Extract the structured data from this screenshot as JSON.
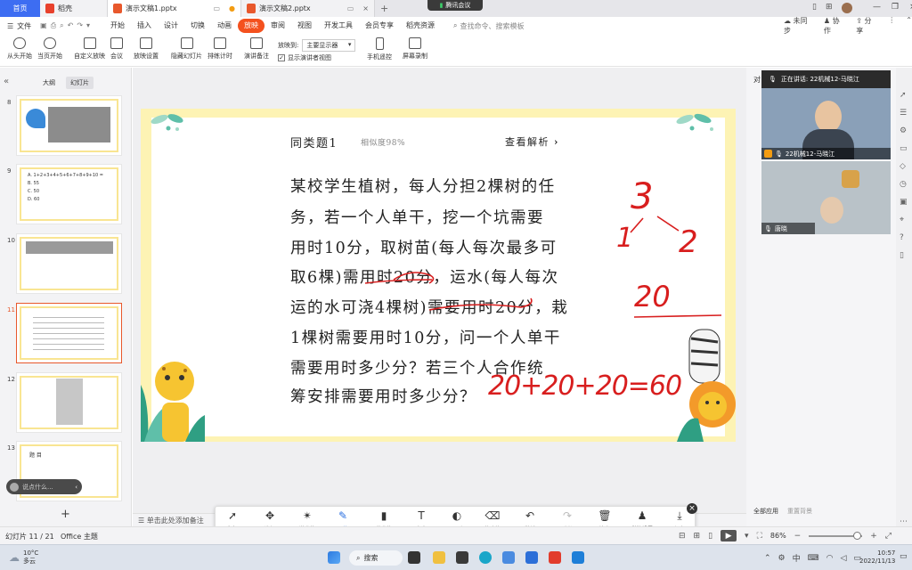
{
  "tabs": {
    "home": "首页",
    "daoke": "稻壳",
    "doc1": "演示文稿1.pptx",
    "doc2": "演示文稿2.pptx",
    "meeting": "腾讯会议"
  },
  "window": {
    "sync": "未同步",
    "collab": "协作",
    "share": "分享"
  },
  "menu": {
    "file": "文件",
    "items": [
      "开始",
      "插入",
      "设计",
      "切换",
      "动画",
      "放映",
      "审阅",
      "视图",
      "开发工具",
      "会员专享",
      "稻壳资源"
    ],
    "search_placeholder": "查找命令、搜索模板"
  },
  "toolbar": {
    "from_start": "从头开始",
    "from_current": "当页开始",
    "custom": "自定义放映",
    "meeting": "会议",
    "settings": "放映设置",
    "hide": "隐藏幻灯片",
    "timing": "排练计时",
    "notes": "演讲备注",
    "show_to_label": "放映到:",
    "show_to_value": "主要显示器",
    "presenter_view": "显示演讲者视图",
    "phone_remote": "手机遥控",
    "screen_record": "屏幕录制"
  },
  "leftpanel": {
    "tab_outline": "大纲",
    "tab_slides": "幻灯片",
    "slide_numbers": [
      "8",
      "9",
      "10",
      "11",
      "12",
      "13"
    ],
    "add": "+",
    "comment_placeholder": "说点什么...",
    "thumb9_lines": [
      "A. 1+2+3+4+5+6+7+8+9+10 =",
      "B. 55",
      "C. 50",
      "D. 60"
    ],
    "thumb13_title": "题 目"
  },
  "slide": {
    "header": "同类题1",
    "similarity": "相似度98%",
    "view_analysis": "查看解析",
    "lines": [
      "某校学生植树，每人分担2棵树的任",
      "务，若一个人单干，挖一个坑需要",
      "用时10分，取树苗(每人每次最多可",
      "取6棵)需用时20分，运水(每人每次",
      "运的水可浇4棵树)需要用时20分，栽",
      "1棵树需要用时10分，问一个人单干",
      "需要用时多少分？若三个人合作统",
      "筹安排需要用时多少分？"
    ],
    "handwriting": {
      "tree": [
        "3",
        "1",
        "2"
      ],
      "twenty": "20",
      "sum": "20+20+20=60"
    }
  },
  "notes_placeholder": "单击此处添加备注",
  "meeting": {
    "speaking": "正在讲话: 22机械12-马晓江",
    "name1": "22机械12-马晓江",
    "name2": "唐晓"
  },
  "right": {
    "all_apply": "全部应用",
    "reset_bg": "重置背景",
    "label_dui": "对"
  },
  "drawbar": {
    "tools": [
      "鼠标",
      "选择",
      "激光笔",
      "画笔",
      "荧光笔",
      "文本",
      "图形",
      "橡皮擦",
      "撤销",
      "重做",
      "清空",
      "批注设置",
      "保存"
    ],
    "close": "×"
  },
  "status": {
    "slide_indicator": "幻灯片 11 / 21",
    "theme": "Office 主题",
    "zoom": "86%"
  },
  "taskbar": {
    "weather_temp": "10°C",
    "weather_desc": "多云",
    "search": "搜索",
    "lang": "中",
    "time": "10:57",
    "date": "2022/11/13"
  },
  "colors": {
    "accent": "#f4511e",
    "home_tab": "#3d6df2",
    "pen": "#d81e1e"
  }
}
